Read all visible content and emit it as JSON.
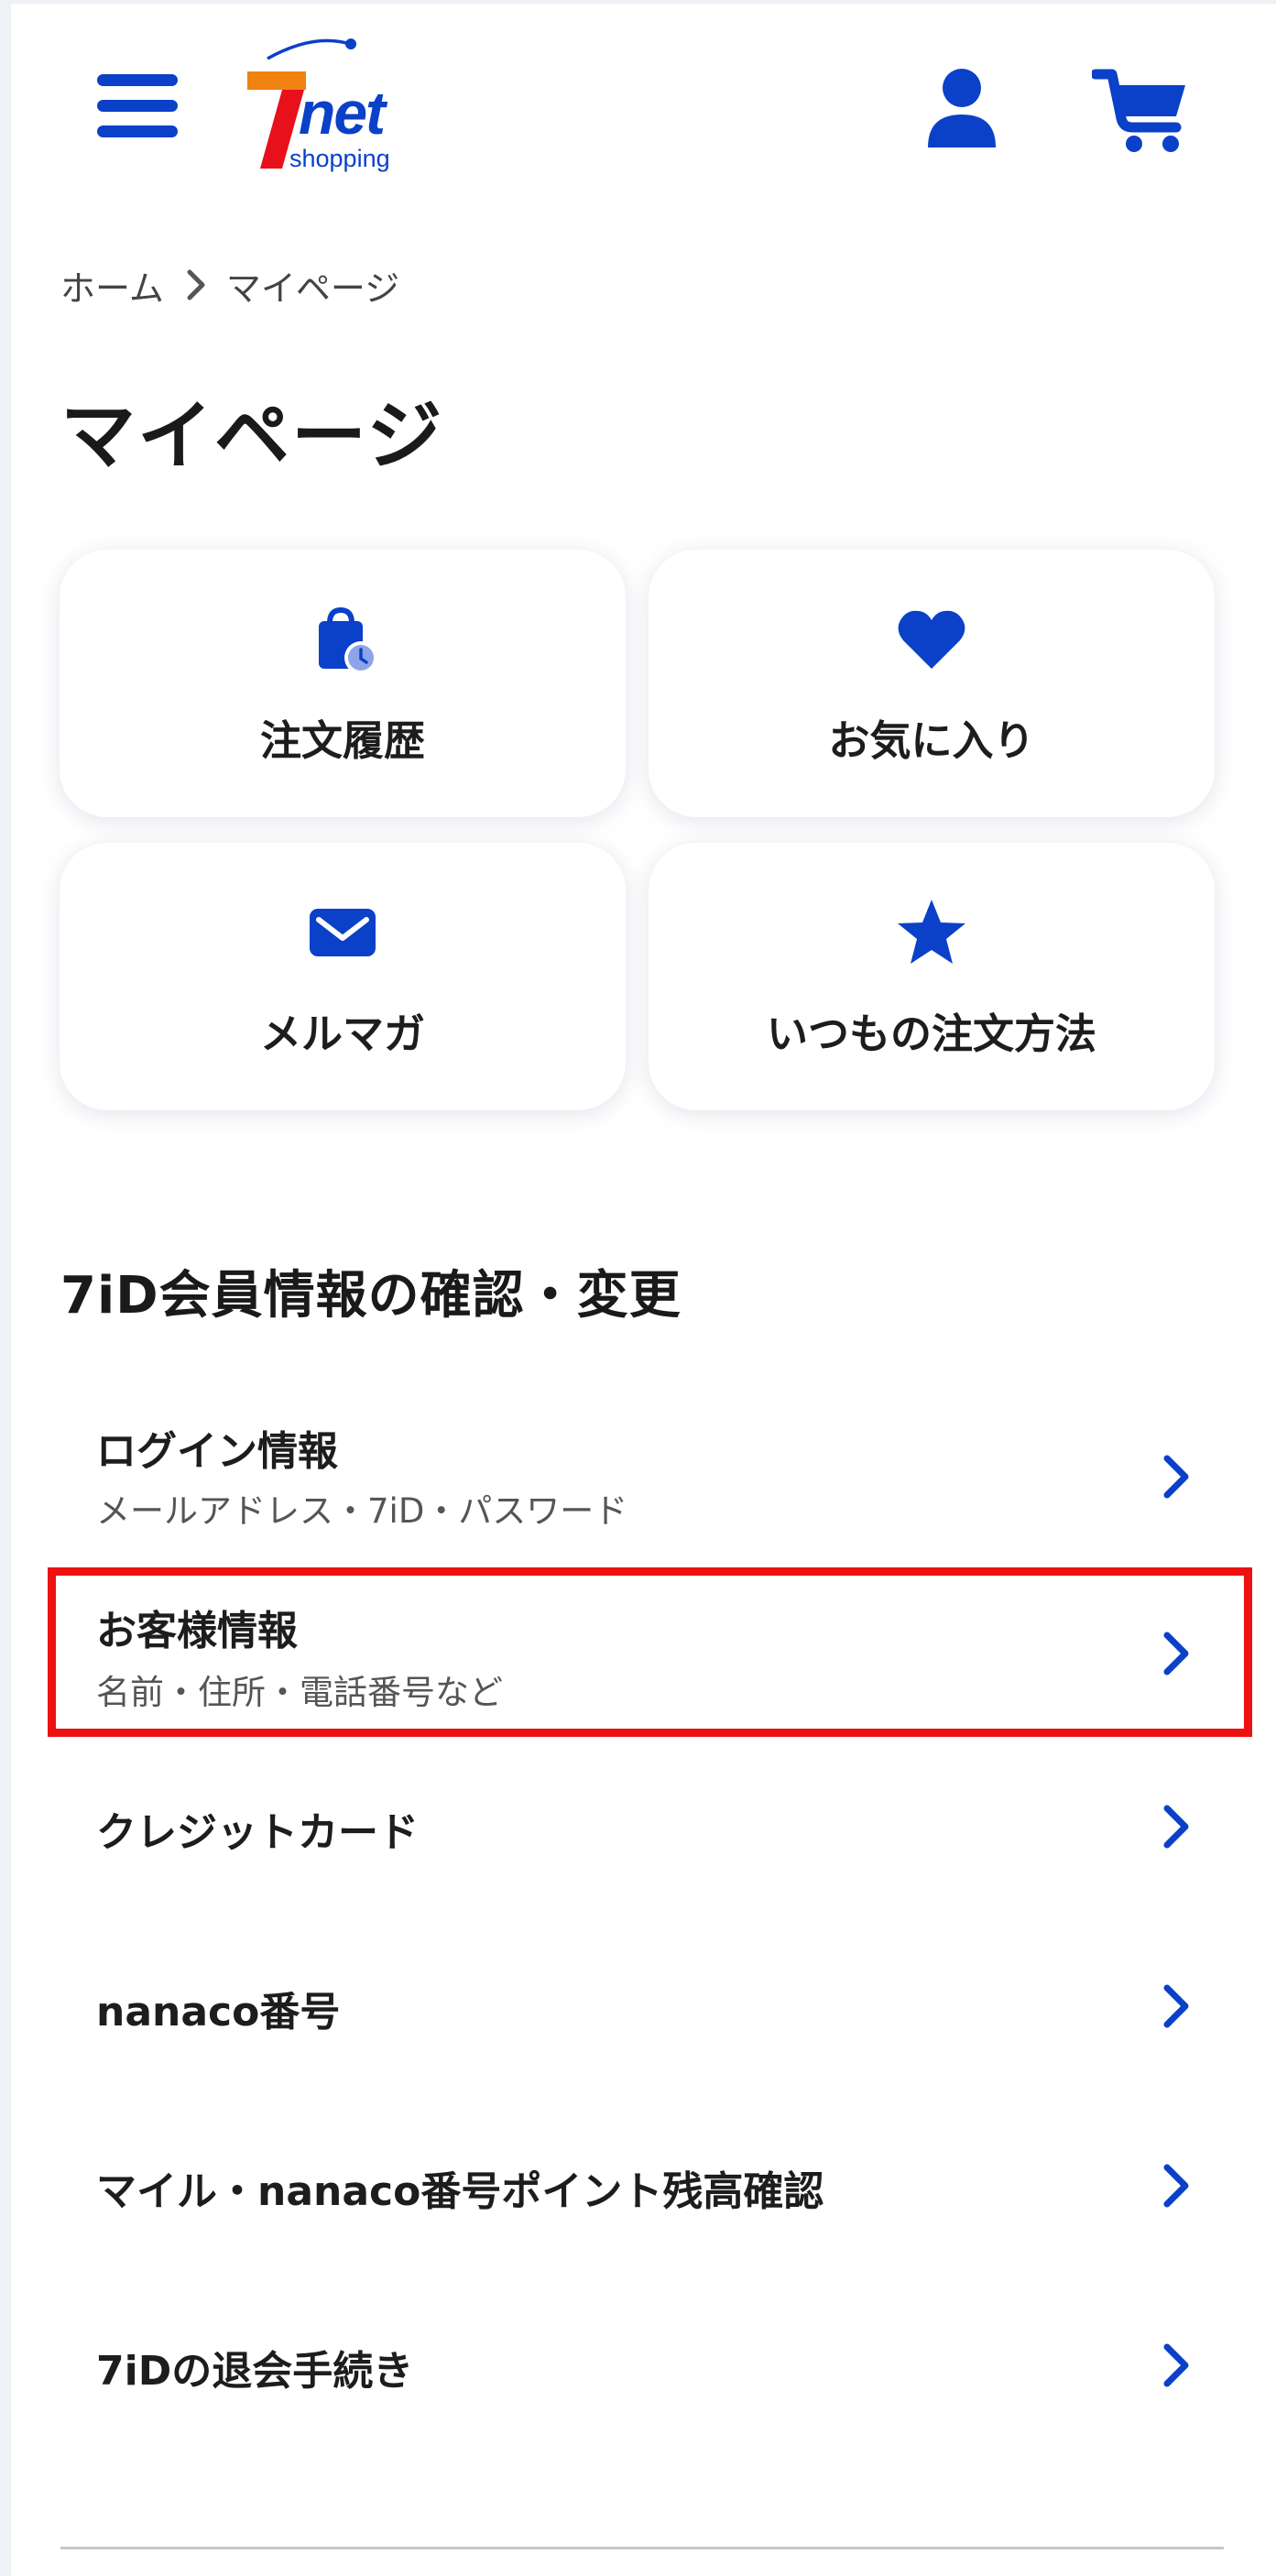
{
  "header": {
    "logo": {
      "brand_number": "7",
      "brand_word": "net",
      "brand_sub": "shopping"
    },
    "menu_icon": "hamburger-icon",
    "user_icon": "user-icon",
    "cart_icon": "cart-icon"
  },
  "breadcrumb": {
    "home": "ホーム",
    "current": "マイページ"
  },
  "page_title": "マイページ",
  "cards": [
    {
      "label": "注文履歴",
      "icon": "shopping-bag-clock-icon"
    },
    {
      "label": "お気に入り",
      "icon": "heart-icon"
    },
    {
      "label": "メルマガ",
      "icon": "mail-icon"
    },
    {
      "label": "いつもの注文方法",
      "icon": "star-icon"
    }
  ],
  "section": {
    "title": "7iD会員情報の確認・変更",
    "items": [
      {
        "label": "ログイン情報",
        "sub": "メールアドレス・7iD・パスワード"
      },
      {
        "label": "お客様情報",
        "sub": "名前・住所・電話番号など",
        "highlighted": true
      },
      {
        "label": "クレジットカード"
      },
      {
        "label": "nanaco番号"
      },
      {
        "label": "マイル・nanaco番号ポイント残高確認"
      },
      {
        "label": "7iDの退会手続き"
      }
    ]
  },
  "colors": {
    "accent": "#0a41c8",
    "highlight": "#ee1111",
    "logo_orange": "#f08212",
    "logo_red": "#e8101b",
    "text": "#1d1d1d"
  }
}
